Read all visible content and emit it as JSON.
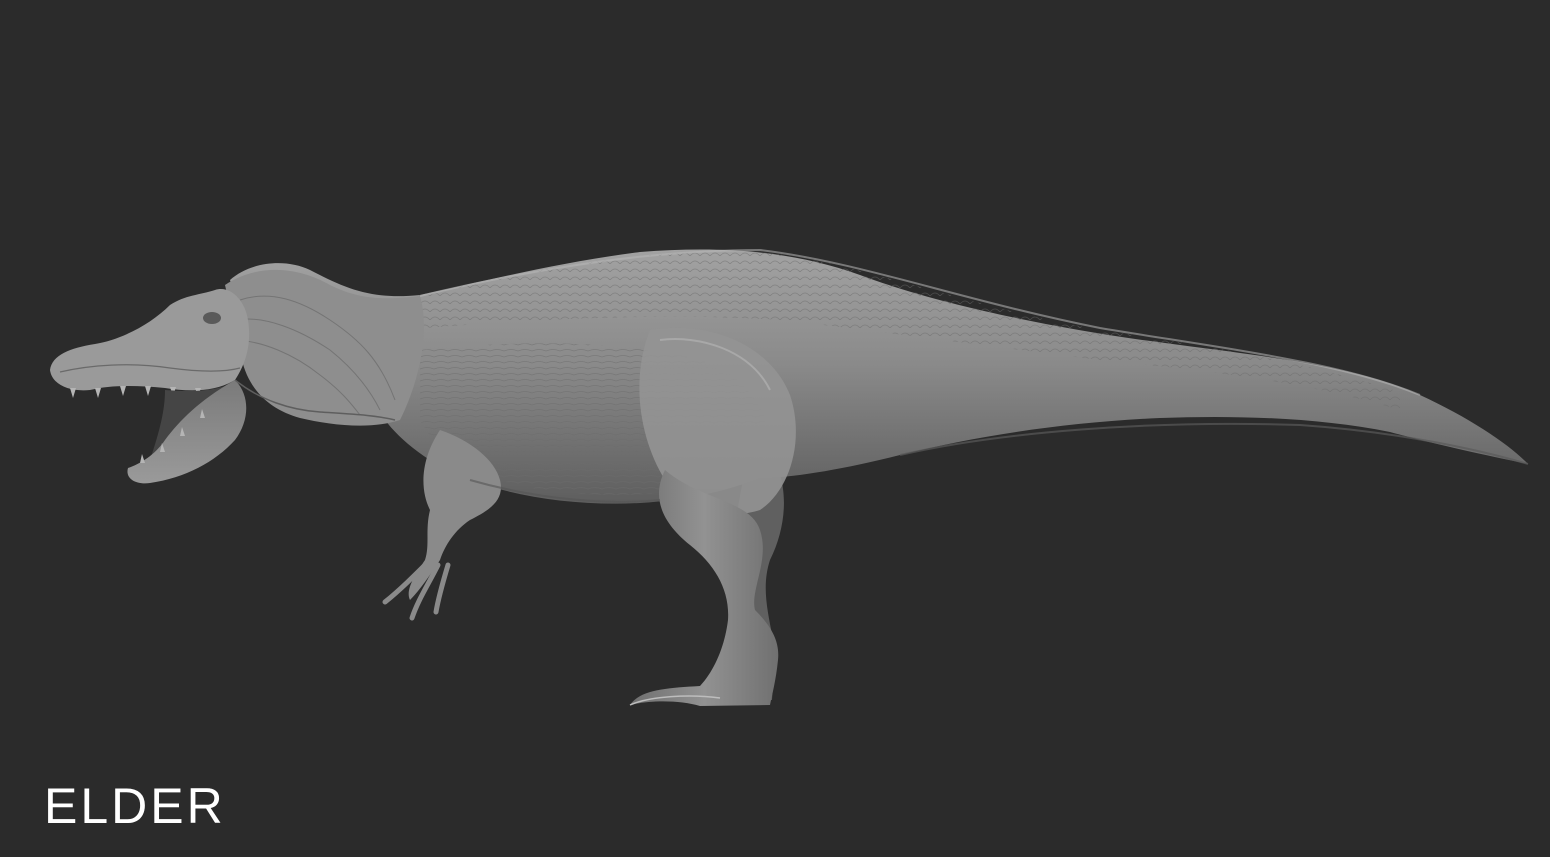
{
  "caption": {
    "label": "ELDER"
  },
  "render": {
    "subject": "spinosaurid-dinosaur-sculpt",
    "background_color": "#2b2b2b",
    "sculpt_color": "#8c8c8c"
  }
}
